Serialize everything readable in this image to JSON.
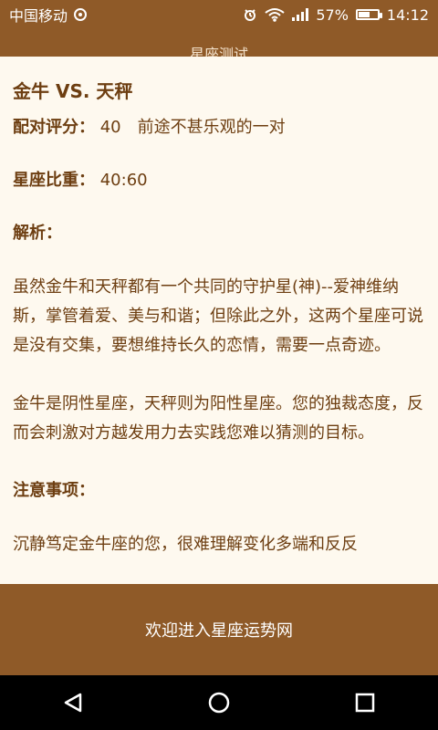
{
  "status_bar": {
    "carrier": "中国移动",
    "battery_percent": "57%",
    "time": "14:12"
  },
  "title_bar": {
    "title": "星座测试"
  },
  "content": {
    "pair_title": "金牛 VS. 天秤",
    "score_label": "配对评分：",
    "score_value": "40　前途不甚乐观的一对",
    "weight_label": "星座比重：",
    "weight_value": "40:60",
    "analysis_label": "解析：",
    "paragraphs": [
      "虽然金牛和天秤都有一个共同的守护星(神)--爱神维纳斯，掌管着爱、美与和谐；但除此之外，这两个星座可说是没有交集，要想维持长久的恋情，需要一点奇迹。",
      "金牛是阴性星座，天秤则为阳性星座。您的独裁态度，反而会刺激对方越发用力去实践您难以猜测的目标。"
    ],
    "notes_label": "注意事项：",
    "notes_partial": "沉静笃定金牛座的您，很难理解变化多端和反反"
  },
  "banner": {
    "text": "欢迎进入星座运势网"
  },
  "colors": {
    "primary": "#8F5A28",
    "text": "#6D3E11",
    "background": "#FEF9EF"
  }
}
